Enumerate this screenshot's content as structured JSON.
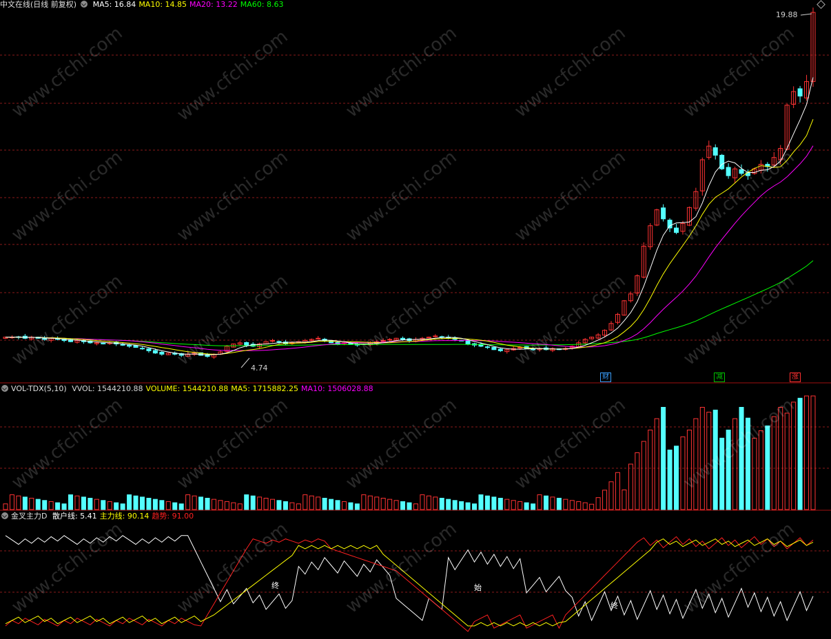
{
  "main_header": {
    "title": "中文在线(日线 前复权)",
    "indicators": [
      {
        "label": "MA5: 16.84",
        "color": "#ffffff"
      },
      {
        "label": "MA10: 14.85",
        "color": "#ffff00"
      },
      {
        "label": "MA20: 13.22",
        "color": "#ff00ff"
      },
      {
        "label": "MA60: 8.63",
        "color": "#00ff00"
      }
    ]
  },
  "vol_header": {
    "title": "VOL-TDX(5,10)",
    "indicators": [
      {
        "label": "VVOL: 1544210.88",
        "color": "#d8d8d8"
      },
      {
        "label": "VOLUME: 1544210.88",
        "color": "#ffff00"
      },
      {
        "label": "MA5: 1715882.25",
        "color": "#ffff00"
      },
      {
        "label": "MA10: 1506028.88",
        "color": "#ff00ff"
      }
    ]
  },
  "ind_header": {
    "title": "金叉主力D",
    "indicators": [
      {
        "label": "散户线: 5.41",
        "color": "#ffffff"
      },
      {
        "label": "主力线: 90.14",
        "color": "#ffff00"
      },
      {
        "label": "趋势: 91.00",
        "color": "#ff2020"
      }
    ]
  },
  "price_high_label": "19.88",
  "price_low_label": "4.74",
  "badges": [
    {
      "text": "财",
      "color": "#3aa0ff"
    },
    {
      "text": "减",
      "color": "#00c000"
    },
    {
      "text": "涨",
      "color": "#ff3030"
    }
  ],
  "signals": [
    "终",
    "始",
    "终"
  ],
  "watermark": "www.cfchi.com",
  "colors": {
    "up": "#ff3333",
    "down": "#54ffff",
    "grid": "#8b1a1a",
    "ma5": "#ffffff",
    "ma10": "#ffff00",
    "ma20": "#ff00ff",
    "ma60": "#00ff00"
  },
  "chart_data": [
    {
      "type": "candlestick",
      "title": "中文在线(日线 前复权)",
      "close_series": [
        5.6,
        5.6,
        5.6,
        5.55,
        5.6,
        5.55,
        5.5,
        5.55,
        5.5,
        5.45,
        5.4,
        5.45,
        5.4,
        5.35,
        5.35,
        5.3,
        5.35,
        5.3,
        5.25,
        5.2,
        5.15,
        5.1,
        5.0,
        4.9,
        4.85,
        4.9,
        4.85,
        4.8,
        4.85,
        4.9,
        4.8,
        4.75,
        4.85,
        4.95,
        5.2,
        5.3,
        5.35,
        5.25,
        5.2,
        5.3,
        5.4,
        5.45,
        5.4,
        5.3,
        5.35,
        5.4,
        5.45,
        5.5,
        5.55,
        5.45,
        5.35,
        5.3,
        5.35,
        5.3,
        5.25,
        5.3,
        5.35,
        5.4,
        5.45,
        5.5,
        5.55,
        5.5,
        5.45,
        5.5,
        5.55,
        5.6,
        5.65,
        5.6,
        5.55,
        5.5,
        5.45,
        5.3,
        5.25,
        5.2,
        5.15,
        5.05,
        5.0,
        5.05,
        5.1,
        5.15,
        5.1,
        5.05,
        5.1,
        5.05,
        5.1,
        5.05,
        5.1,
        5.2,
        5.35,
        5.5,
        5.6,
        5.7,
        5.9,
        6.2,
        6.6,
        7.2,
        7.5,
        8.3,
        9.6,
        10.5,
        11.2,
        10.8,
        10.4,
        10.2,
        10.6,
        11.3,
        12.0,
        13.4,
        14.0,
        13.6,
        13.0,
        12.7,
        13.0,
        12.8,
        12.7,
        13.0,
        13.2,
        13.1,
        13.5,
        13.9,
        15.8,
        16.4,
        16.2,
        16.84,
        19.88
      ],
      "ylim": [
        4.74,
        19.88
      ],
      "annotations": [
        "19.88",
        "4.74"
      ]
    },
    {
      "type": "bar",
      "title": "VOL-TDX(5,10)",
      "series": [
        {
          "name": "VOLUME",
          "values_relative": "low volume until late rally, peak near end"
        }
      ],
      "last": {
        "VOLUME": 1544210.88,
        "MA5": 1715882.25,
        "MA10": 1506028.88
      }
    },
    {
      "type": "line",
      "title": "金叉主力D",
      "series": [
        {
          "name": "散户线",
          "last": 5.41
        },
        {
          "name": "主力线",
          "last": 90.14
        },
        {
          "name": "趋势",
          "last": 91.0
        }
      ],
      "ylim": [
        0,
        100
      ]
    }
  ]
}
